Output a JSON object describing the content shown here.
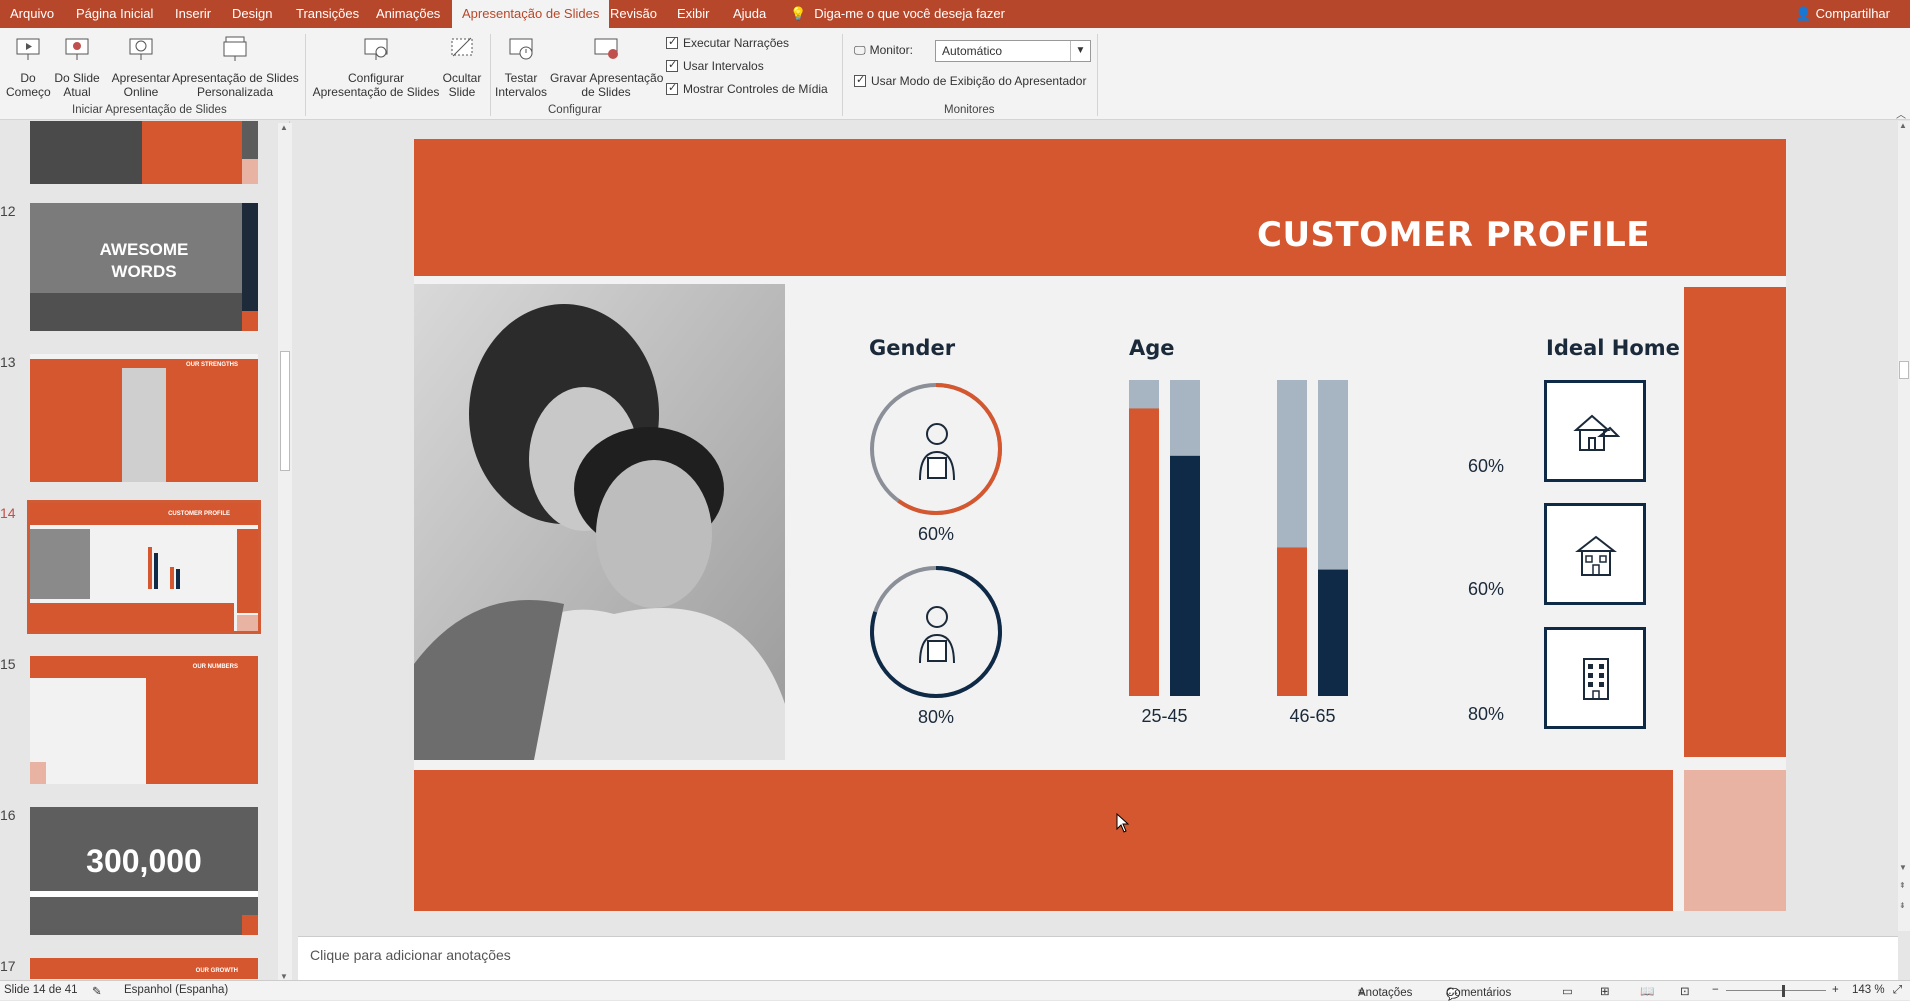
{
  "menu": {
    "tabs": [
      "Arquivo",
      "Página Inicial",
      "Inserir",
      "Design",
      "Transições",
      "Animações",
      "Apresentação de Slides",
      "Revisão",
      "Exibir",
      "Ajuda"
    ],
    "active": "Apresentação de Slides",
    "tell_me": "Diga-me o que você deseja fazer",
    "share": "Compartilhar"
  },
  "ribbon": {
    "start": {
      "from_beginning": "Do\nComeço",
      "from_current": "Do Slide\nAtual",
      "present_online": "Apresentar\nOnline",
      "custom_show": "Apresentação de Slides\nPersonalizada",
      "group_label": "Iniciar Apresentação de Slides"
    },
    "setup": {
      "setup_show": "Configurar\nApresentação de Slides",
      "hide_slide": "Ocultar\nSlide",
      "rehearse": "Testar\nIntervalos",
      "record": "Gravar Apresentação\nde Slides",
      "chk_narrations": "Executar Narrações",
      "chk_timings": "Usar Intervalos",
      "chk_media": "Mostrar Controles de Mídia",
      "group_label": "Configurar"
    },
    "monitors": {
      "monitor_label": "Monitor:",
      "monitor_value": "Automático",
      "presenter_view": "Usar Modo de Exibição do Apresentador",
      "group_label": "Monitores"
    }
  },
  "thumbnails": [
    {
      "num": "12",
      "text": "AWESOME\nWORDS"
    },
    {
      "num": "13",
      "text": "OUR STRENGTHS"
    },
    {
      "num": "14",
      "text": "CUSTOMER PROFILE"
    },
    {
      "num": "15",
      "text": "OUR NUMBERS"
    },
    {
      "num": "16",
      "text": "300,000"
    },
    {
      "num": "17",
      "text": "OUR GROWTH"
    }
  ],
  "slide": {
    "title": "CUSTOMER PROFILE",
    "gender": {
      "heading": "Gender",
      "female_pct": "60%",
      "male_pct": "80%"
    },
    "age": {
      "heading": "Age"
    },
    "ideal_home": {
      "heading": "Ideal Home",
      "pct1": "60%",
      "pct2": "60%",
      "pct3": "80%"
    },
    "colors": {
      "orange": "#d5572f",
      "navy": "#0f2a47",
      "gray": "#a7b4c1",
      "pink": "#e8b3a3"
    }
  },
  "chart_data": {
    "type": "bar",
    "categories": [
      "25-45",
      "46-65"
    ],
    "series": [
      {
        "values": [
          91,
          47
        ]
      },
      {
        "values": [
          76,
          40
        ]
      }
    ],
    "ylim": [
      0,
      100
    ]
  },
  "notes": {
    "placeholder": "Clique para adicionar anotações"
  },
  "status": {
    "slide_info": "Slide 14 de 41",
    "language": "Espanhol (Espanha)",
    "notes_btn": "Anotações",
    "comments_btn": "Comentários",
    "zoom": "143 %"
  }
}
